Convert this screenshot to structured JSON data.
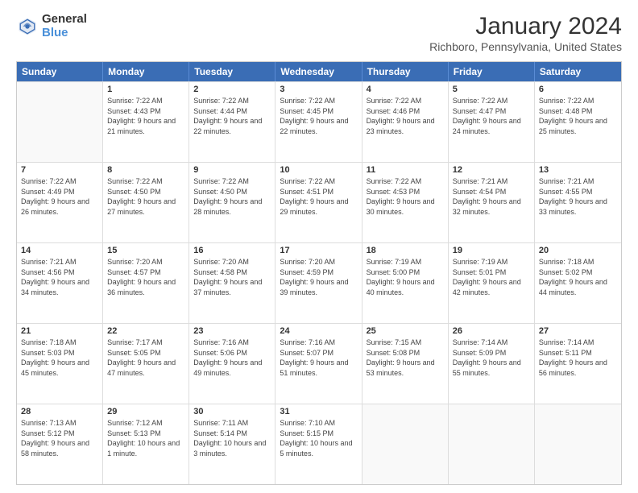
{
  "header": {
    "logo_general": "General",
    "logo_blue": "Blue",
    "title": "January 2024",
    "location": "Richboro, Pennsylvania, United States"
  },
  "days_of_week": [
    "Sunday",
    "Monday",
    "Tuesday",
    "Wednesday",
    "Thursday",
    "Friday",
    "Saturday"
  ],
  "weeks": [
    [
      {
        "day": "",
        "sunrise": "",
        "sunset": "",
        "daylight": ""
      },
      {
        "day": "1",
        "sunrise": "Sunrise: 7:22 AM",
        "sunset": "Sunset: 4:43 PM",
        "daylight": "Daylight: 9 hours and 21 minutes."
      },
      {
        "day": "2",
        "sunrise": "Sunrise: 7:22 AM",
        "sunset": "Sunset: 4:44 PM",
        "daylight": "Daylight: 9 hours and 22 minutes."
      },
      {
        "day": "3",
        "sunrise": "Sunrise: 7:22 AM",
        "sunset": "Sunset: 4:45 PM",
        "daylight": "Daylight: 9 hours and 22 minutes."
      },
      {
        "day": "4",
        "sunrise": "Sunrise: 7:22 AM",
        "sunset": "Sunset: 4:46 PM",
        "daylight": "Daylight: 9 hours and 23 minutes."
      },
      {
        "day": "5",
        "sunrise": "Sunrise: 7:22 AM",
        "sunset": "Sunset: 4:47 PM",
        "daylight": "Daylight: 9 hours and 24 minutes."
      },
      {
        "day": "6",
        "sunrise": "Sunrise: 7:22 AM",
        "sunset": "Sunset: 4:48 PM",
        "daylight": "Daylight: 9 hours and 25 minutes."
      }
    ],
    [
      {
        "day": "7",
        "sunrise": "Sunrise: 7:22 AM",
        "sunset": "Sunset: 4:49 PM",
        "daylight": "Daylight: 9 hours and 26 minutes."
      },
      {
        "day": "8",
        "sunrise": "Sunrise: 7:22 AM",
        "sunset": "Sunset: 4:50 PM",
        "daylight": "Daylight: 9 hours and 27 minutes."
      },
      {
        "day": "9",
        "sunrise": "Sunrise: 7:22 AM",
        "sunset": "Sunset: 4:50 PM",
        "daylight": "Daylight: 9 hours and 28 minutes."
      },
      {
        "day": "10",
        "sunrise": "Sunrise: 7:22 AM",
        "sunset": "Sunset: 4:51 PM",
        "daylight": "Daylight: 9 hours and 29 minutes."
      },
      {
        "day": "11",
        "sunrise": "Sunrise: 7:22 AM",
        "sunset": "Sunset: 4:53 PM",
        "daylight": "Daylight: 9 hours and 30 minutes."
      },
      {
        "day": "12",
        "sunrise": "Sunrise: 7:21 AM",
        "sunset": "Sunset: 4:54 PM",
        "daylight": "Daylight: 9 hours and 32 minutes."
      },
      {
        "day": "13",
        "sunrise": "Sunrise: 7:21 AM",
        "sunset": "Sunset: 4:55 PM",
        "daylight": "Daylight: 9 hours and 33 minutes."
      }
    ],
    [
      {
        "day": "14",
        "sunrise": "Sunrise: 7:21 AM",
        "sunset": "Sunset: 4:56 PM",
        "daylight": "Daylight: 9 hours and 34 minutes."
      },
      {
        "day": "15",
        "sunrise": "Sunrise: 7:20 AM",
        "sunset": "Sunset: 4:57 PM",
        "daylight": "Daylight: 9 hours and 36 minutes."
      },
      {
        "day": "16",
        "sunrise": "Sunrise: 7:20 AM",
        "sunset": "Sunset: 4:58 PM",
        "daylight": "Daylight: 9 hours and 37 minutes."
      },
      {
        "day": "17",
        "sunrise": "Sunrise: 7:20 AM",
        "sunset": "Sunset: 4:59 PM",
        "daylight": "Daylight: 9 hours and 39 minutes."
      },
      {
        "day": "18",
        "sunrise": "Sunrise: 7:19 AM",
        "sunset": "Sunset: 5:00 PM",
        "daylight": "Daylight: 9 hours and 40 minutes."
      },
      {
        "day": "19",
        "sunrise": "Sunrise: 7:19 AM",
        "sunset": "Sunset: 5:01 PM",
        "daylight": "Daylight: 9 hours and 42 minutes."
      },
      {
        "day": "20",
        "sunrise": "Sunrise: 7:18 AM",
        "sunset": "Sunset: 5:02 PM",
        "daylight": "Daylight: 9 hours and 44 minutes."
      }
    ],
    [
      {
        "day": "21",
        "sunrise": "Sunrise: 7:18 AM",
        "sunset": "Sunset: 5:03 PM",
        "daylight": "Daylight: 9 hours and 45 minutes."
      },
      {
        "day": "22",
        "sunrise": "Sunrise: 7:17 AM",
        "sunset": "Sunset: 5:05 PM",
        "daylight": "Daylight: 9 hours and 47 minutes."
      },
      {
        "day": "23",
        "sunrise": "Sunrise: 7:16 AM",
        "sunset": "Sunset: 5:06 PM",
        "daylight": "Daylight: 9 hours and 49 minutes."
      },
      {
        "day": "24",
        "sunrise": "Sunrise: 7:16 AM",
        "sunset": "Sunset: 5:07 PM",
        "daylight": "Daylight: 9 hours and 51 minutes."
      },
      {
        "day": "25",
        "sunrise": "Sunrise: 7:15 AM",
        "sunset": "Sunset: 5:08 PM",
        "daylight": "Daylight: 9 hours and 53 minutes."
      },
      {
        "day": "26",
        "sunrise": "Sunrise: 7:14 AM",
        "sunset": "Sunset: 5:09 PM",
        "daylight": "Daylight: 9 hours and 55 minutes."
      },
      {
        "day": "27",
        "sunrise": "Sunrise: 7:14 AM",
        "sunset": "Sunset: 5:11 PM",
        "daylight": "Daylight: 9 hours and 56 minutes."
      }
    ],
    [
      {
        "day": "28",
        "sunrise": "Sunrise: 7:13 AM",
        "sunset": "Sunset: 5:12 PM",
        "daylight": "Daylight: 9 hours and 58 minutes."
      },
      {
        "day": "29",
        "sunrise": "Sunrise: 7:12 AM",
        "sunset": "Sunset: 5:13 PM",
        "daylight": "Daylight: 10 hours and 1 minute."
      },
      {
        "day": "30",
        "sunrise": "Sunrise: 7:11 AM",
        "sunset": "Sunset: 5:14 PM",
        "daylight": "Daylight: 10 hours and 3 minutes."
      },
      {
        "day": "31",
        "sunrise": "Sunrise: 7:10 AM",
        "sunset": "Sunset: 5:15 PM",
        "daylight": "Daylight: 10 hours and 5 minutes."
      },
      {
        "day": "",
        "sunrise": "",
        "sunset": "",
        "daylight": ""
      },
      {
        "day": "",
        "sunrise": "",
        "sunset": "",
        "daylight": ""
      },
      {
        "day": "",
        "sunrise": "",
        "sunset": "",
        "daylight": ""
      }
    ]
  ]
}
